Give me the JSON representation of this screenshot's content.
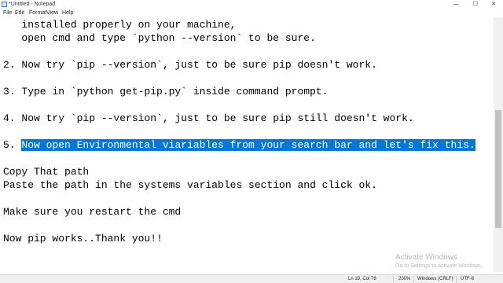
{
  "window": {
    "title": "*Untitled - Notepad",
    "controls": {
      "minimize": "—",
      "maximize": "☐",
      "close": "✕"
    }
  },
  "menu": [
    "File",
    "Edit",
    "Format",
    "View",
    "Help"
  ],
  "editor": {
    "lines": [
      {
        "text": "   installed properly on your machine,"
      },
      {
        "text": "   open cmd and type `python --version` to be sure."
      },
      {
        "text": ""
      },
      {
        "text": "2. Now try `pip --version`, just to be sure pip doesn't work."
      },
      {
        "text": ""
      },
      {
        "text": "3. Type in `python get-pip.py` inside command prompt."
      },
      {
        "text": ""
      },
      {
        "text": "4. Now try `pip --version`, just to be sure pip still doesn't work."
      },
      {
        "text": ""
      },
      {
        "prefix": "5. ",
        "selected": "Now open Environmental viariables from your search bar and let's fix this."
      },
      {
        "text": ""
      },
      {
        "text": "Copy That path"
      },
      {
        "text": "Paste the path in the systems variables section and click ok."
      },
      {
        "text": ""
      },
      {
        "text": "Make sure you restart the cmd"
      },
      {
        "text": ""
      },
      {
        "text": "Now pip works..Thank you!!"
      }
    ],
    "selection_color": "#0078d7"
  },
  "watermark": {
    "title": "Activate Windows",
    "subtitle": "Go to Settings to activate Windows."
  },
  "status": {
    "position": "Ln 19, Col 78",
    "zoom": "200%",
    "line_endings": "Windows (CRLF)",
    "encoding": "UTF-8"
  }
}
